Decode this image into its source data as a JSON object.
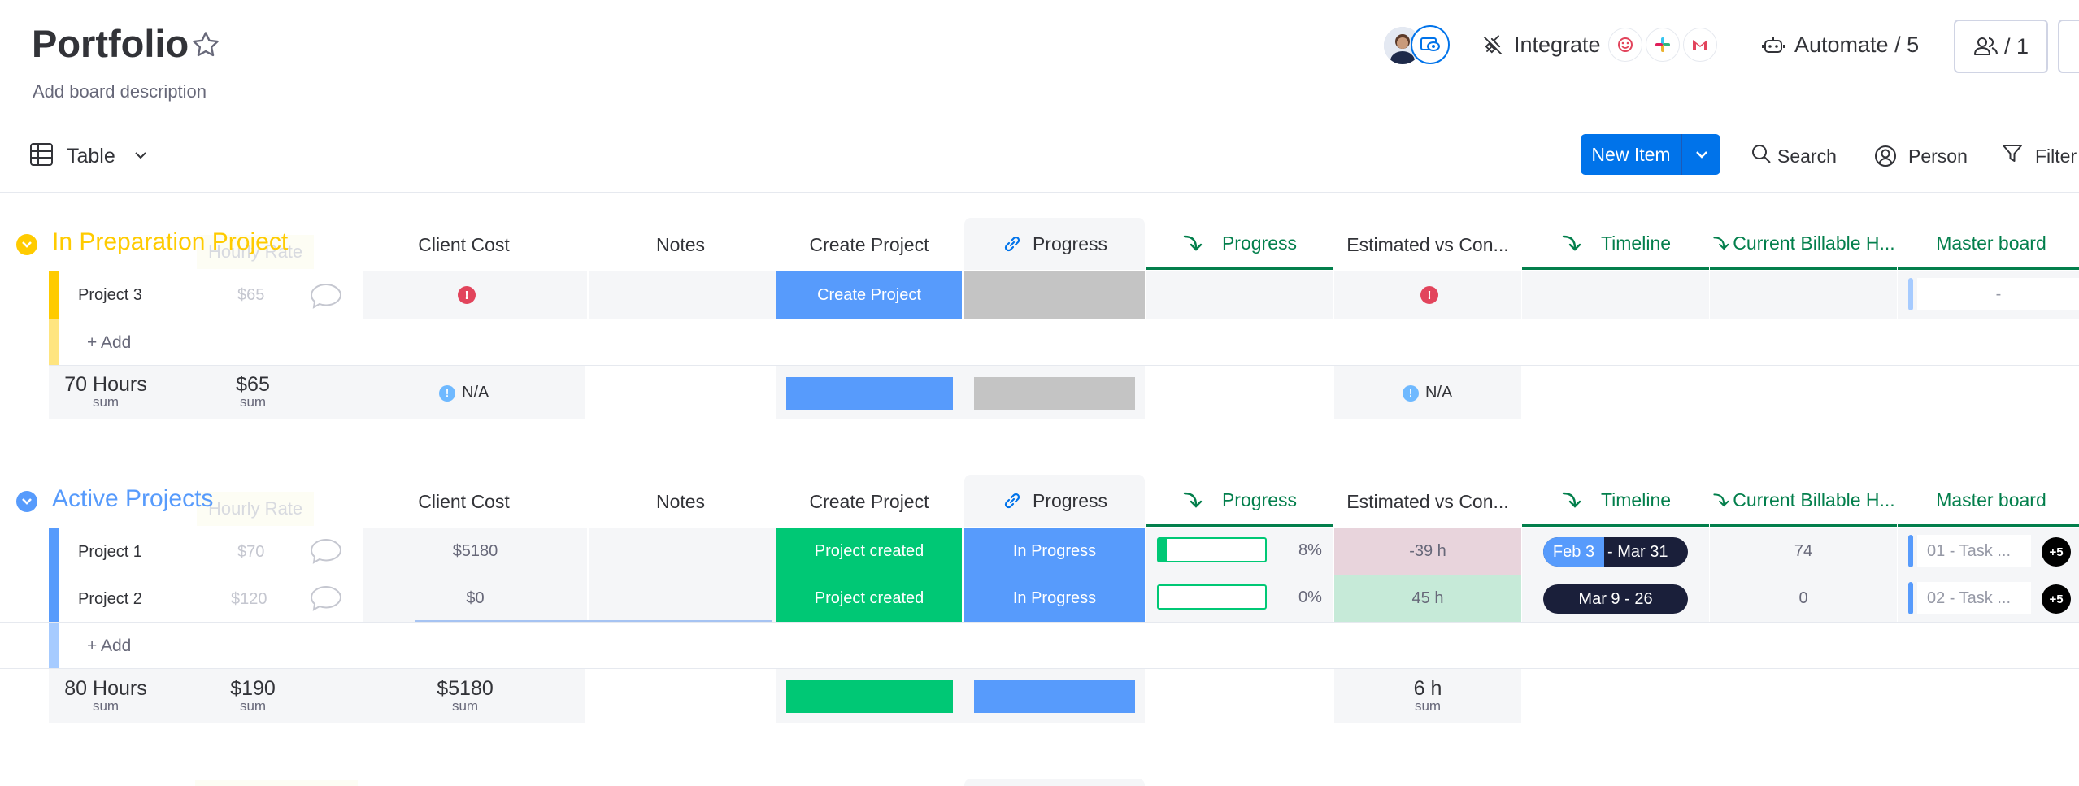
{
  "board": {
    "title": "Portfolio",
    "description": "Add board description"
  },
  "header": {
    "integrate_label": "Integrate",
    "automate_label": "Automate / 5",
    "members_label": "/ 1"
  },
  "toolbar": {
    "view_label": "Table",
    "new_item_label": "New Item",
    "search_label": "Search",
    "person_label": "Person",
    "filter_label": "Filter"
  },
  "columns": {
    "client_cost": "Client Cost",
    "notes": "Notes",
    "create_project": "Create Project",
    "progress_link": "Progress",
    "progress": "Progress",
    "estimated": "Estimated vs Con...",
    "timeline": "Timeline",
    "billable": "Current Billable H...",
    "master": "Master board"
  },
  "groups": [
    {
      "name": "In Preparation Project",
      "color": "#ffcb00",
      "ghost_header": "Hourly Rate",
      "items": [
        {
          "name": "Project 3",
          "rate": "$65",
          "create_button": "Create Project",
          "master": "-"
        }
      ],
      "add_label": "+ Add",
      "summary": {
        "hours": "70 Hours",
        "hours_label": "sum",
        "rate": "$65",
        "rate_label": "sum",
        "client_cost": "N/A",
        "estimated": "N/A"
      }
    },
    {
      "name": "Active Projects",
      "color": "#579bfc",
      "ghost_header": "Hourly Rate",
      "items": [
        {
          "name": "Project 1",
          "rate": "$70",
          "client_cost": "$5180",
          "create_status": "Project created",
          "progress_status": "In Progress",
          "progress_pct": "8%",
          "progress_value": 0.08,
          "estimated": "-39 h",
          "timeline_start": "Feb 3",
          "timeline_end": "- Mar 31",
          "timeline_filled_fraction": 0.42,
          "billable": "74",
          "master": "01 - Task ...",
          "master_more": "+5"
        },
        {
          "name": "Project 2",
          "rate": "$120",
          "client_cost": "$0",
          "create_status": "Project created",
          "progress_status": "In Progress",
          "progress_pct": "0%",
          "progress_value": 0.0,
          "estimated": "45 h",
          "timeline": "Mar 9 - 26",
          "billable": "0",
          "master": "02 - Task ...",
          "master_more": "+5"
        }
      ],
      "add_label": "+ Add",
      "summary": {
        "hours": "80 Hours",
        "hours_label": "sum",
        "rate": "$190",
        "rate_label": "sum",
        "client_cost": "$5180",
        "client_cost_label": "sum",
        "estimated": "6 h",
        "estimated_label": "sum"
      }
    }
  ],
  "colors": {
    "accent": "#0073ea",
    "status_blue": "#579bfc",
    "status_green": "#00c875",
    "status_grey": "#c4c4c4",
    "link_green": "#037f4c",
    "negative_bg": "#e8d4dc",
    "positive_bg": "#c6ead8",
    "timeline_dark": "#1a1f3a",
    "error_red": "#e2445c"
  },
  "icons": {
    "star": "star-icon",
    "table": "table-icon",
    "chevron": "chevron-down-icon",
    "search": "search-icon",
    "person": "person-icon",
    "filter": "filter-icon",
    "integrate": "integrate-icon",
    "automate": "robot-icon",
    "members": "people-icon",
    "link": "link-icon",
    "mirror": "mirror-arrow-icon",
    "comment": "comment-icon",
    "error": "error-icon",
    "info": "info-icon"
  }
}
